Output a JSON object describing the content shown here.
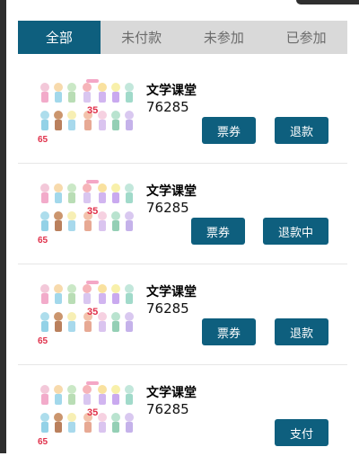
{
  "tabs": [
    {
      "label": "全部",
      "active": true
    },
    {
      "label": "未付款",
      "active": false
    },
    {
      "label": "未参加",
      "active": false
    },
    {
      "label": "已参加",
      "active": false
    }
  ],
  "orders": [
    {
      "title": "文学课堂",
      "price": "76285",
      "ticket_label": "票券",
      "action_label": "退款",
      "number_a": "35",
      "number_b": "65"
    },
    {
      "title": "文学课堂",
      "price": "76285",
      "ticket_label": "票券",
      "action_label": "退款中",
      "number_a": "35",
      "number_b": "65"
    },
    {
      "title": "文学课堂",
      "price": "76285",
      "ticket_label": "票券",
      "action_label": "退款",
      "number_a": "35",
      "number_b": "65"
    },
    {
      "title": "文学课堂",
      "price": "76285",
      "ticket_label": "",
      "action_label": "支付",
      "number_a": "35",
      "number_b": "65"
    }
  ],
  "colors": {
    "accent": "#0e5f7e",
    "tab_bg": "#d9d9d9"
  }
}
